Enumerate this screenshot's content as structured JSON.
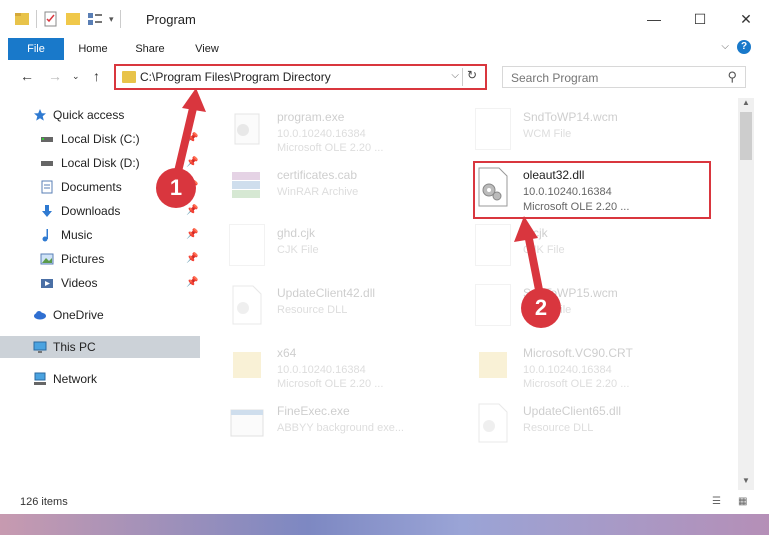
{
  "window": {
    "title": "Program",
    "minimize": "—",
    "maximize": "☐",
    "close": "✕"
  },
  "ribbon": {
    "tabs": [
      "File",
      "Home",
      "Share",
      "View"
    ],
    "help": "?"
  },
  "address": {
    "path": "C:\\Program Files\\Program Directory",
    "search_placeholder": "Search Program"
  },
  "nav": {
    "items": [
      {
        "label": "Quick access",
        "icon": "star-icon"
      },
      {
        "label": "Local Disk (C:)",
        "icon": "drive-icon",
        "pinned": true
      },
      {
        "label": "Local Disk (D:)",
        "icon": "drive-icon",
        "pinned": true
      },
      {
        "label": "Documents",
        "icon": "documents-icon",
        "pinned": true
      },
      {
        "label": "Downloads",
        "icon": "downloads-icon",
        "pinned": true
      },
      {
        "label": "Music",
        "icon": "music-icon",
        "pinned": true
      },
      {
        "label": "Pictures",
        "icon": "pictures-icon",
        "pinned": true
      },
      {
        "label": "Videos",
        "icon": "videos-icon",
        "pinned": true
      },
      {
        "label": "OneDrive",
        "icon": "cloud-icon"
      },
      {
        "label": "This PC",
        "icon": "pc-icon"
      },
      {
        "label": "Network",
        "icon": "network-icon"
      }
    ]
  },
  "files": [
    {
      "name": "program.exe",
      "line1": "10.0.10240.16384",
      "line2": "Microsoft OLE 2.20 ..."
    },
    {
      "name": "SndToWP14.wcm",
      "line1": "WCM File",
      "line2": ""
    },
    {
      "name": "certificates.cab",
      "line1": "WinRAR Archive",
      "line2": ""
    },
    {
      "name": "oleaut32.dll",
      "line1": "10.0.10240.16384",
      "line2": "Microsoft OLE 2.20 ..."
    },
    {
      "name": "ghd.cjk",
      "line1": "CJK File",
      "line2": ""
    },
    {
      "name": "b.cjk",
      "line1": "CJK File",
      "line2": ""
    },
    {
      "name": "UpdateClient42.dll",
      "line1": "Resource DLL",
      "line2": ""
    },
    {
      "name": "SndToWP15.wcm",
      "line1": "WCM File",
      "line2": ""
    },
    {
      "name": "x64",
      "line1": "10.0.10240.16384",
      "line2": "Microsoft OLE 2.20 ..."
    },
    {
      "name": "Microsoft.VC90.CRT",
      "line1": "10.0.10240.16384",
      "line2": "Microsoft OLE 2.20 ..."
    },
    {
      "name": "FineExec.exe",
      "line1": "ABBYY background exe...",
      "line2": ""
    },
    {
      "name": "UpdateClient65.dll",
      "line1": "Resource DLL",
      "line2": ""
    }
  ],
  "status": {
    "count": "126 items"
  },
  "callouts": [
    "1",
    "2"
  ],
  "colors": {
    "accent": "#1979ca",
    "highlight": "#d9363e",
    "selected": "#ccd2d8"
  }
}
